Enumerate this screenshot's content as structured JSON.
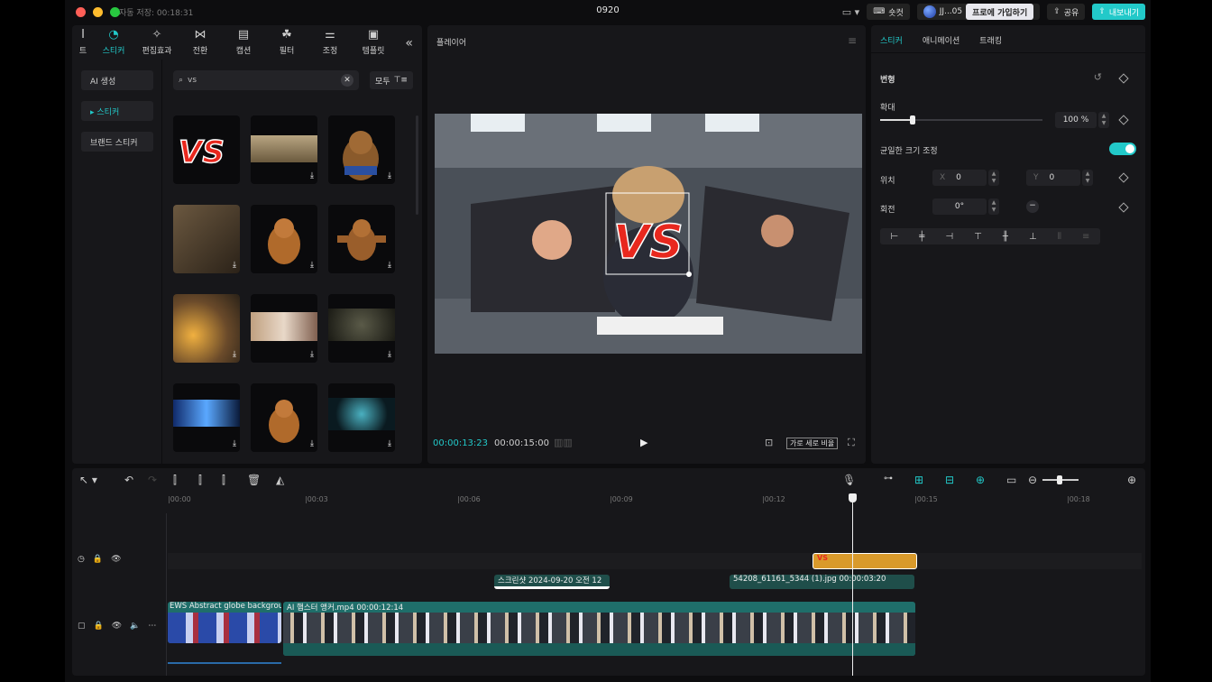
{
  "window": {
    "title": "0920",
    "autosave": "자동 저장: 00:18:31"
  },
  "topbar": {
    "shortcut_label": "숏컷",
    "user_name": "JJ...05",
    "pro_label": "프로에 가입하기",
    "share_label": "공유",
    "export_label": "내보내기"
  },
  "left_panel": {
    "tabs": [
      {
        "label": "트",
        "icon": "text-icon"
      },
      {
        "label": "스티커",
        "icon": "sticker-icon",
        "active": true
      },
      {
        "label": "편집효과",
        "icon": "effects-icon"
      },
      {
        "label": "전환",
        "icon": "transition-icon"
      },
      {
        "label": "캡션",
        "icon": "caption-icon"
      },
      {
        "label": "필터",
        "icon": "filter-icon"
      },
      {
        "label": "조정",
        "icon": "adjust-icon"
      },
      {
        "label": "템플릿",
        "icon": "template-icon"
      }
    ],
    "categories": [
      {
        "label": "AI 생성"
      },
      {
        "label": "▸ 스티커",
        "active": true
      },
      {
        "label": "브랜드 스티커"
      }
    ],
    "search_value": "vs",
    "filter_label": "모두"
  },
  "player": {
    "title": "플레이어",
    "current_time": "00:00:13:23",
    "duration": "00:00:15:00",
    "ratio_label": "가로 세로 비율"
  },
  "right_panel": {
    "tabs": [
      "스티커",
      "애니메이션",
      "트래킹"
    ],
    "transform_label": "변형",
    "scale_label": "확대",
    "scale_value": "100 %",
    "scale_level": 0.2,
    "uniform_label": "균일한 크기 조정",
    "position_label": "위치",
    "pos_x_prefix": "X",
    "pos_x": "0",
    "pos_y_prefix": "Y",
    "pos_y": "0",
    "rotation_label": "회전",
    "rotation_value": "0°",
    "accent": "#22c9c9"
  },
  "timeline": {
    "ruler": [
      "|00:00",
      "|00:03",
      "|00:06",
      "|00:09",
      "|00:12",
      "|00:15",
      "|00:18"
    ],
    "clips": {
      "screenshot_label": "스크린샷 2024-09-20 오전 12",
      "image_label": "54208_61161_5344 (1).jpg   00:00:03:20",
      "bg_label": "EWS Abstract globe backgrou",
      "main_label": "AI 햄스터 앵커.mp4   00:00:12:14"
    },
    "sticker_color": "#d99a2b",
    "video_track_color": "#1f6e6a"
  }
}
